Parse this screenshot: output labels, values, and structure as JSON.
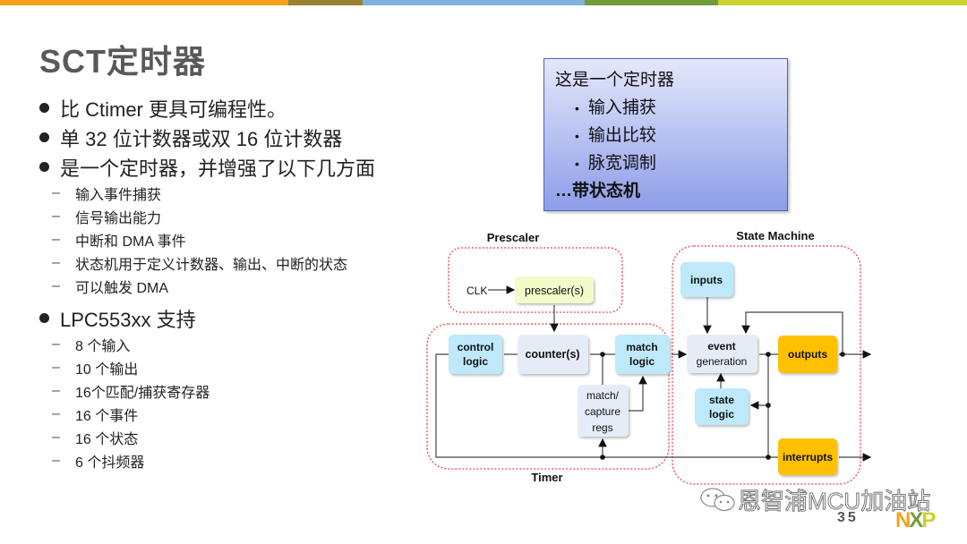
{
  "topbar_colors": [
    "#f7a11a",
    "#9b8132",
    "#7fb2dc",
    "#739b3c",
    "#c9d22e"
  ],
  "slide": {
    "title": "SCT定时器",
    "page_number": "35"
  },
  "bullets": [
    {
      "level": 1,
      "text": "比 Ctimer 更具可编程性。"
    },
    {
      "level": 1,
      "text": "单 32 位计数器或双 16 位计数器"
    },
    {
      "level": 1,
      "text": "是一个定时器，并增强了以下几方面"
    },
    {
      "level": 2,
      "text": "输入事件捕获"
    },
    {
      "level": 2,
      "text": "信号输出能力"
    },
    {
      "level": 2,
      "text": "中断和 DMA 事件"
    },
    {
      "level": 2,
      "text": "状态机用于定义计数器、输出、中断的状态"
    },
    {
      "level": 2,
      "text": "可以触发 DMA"
    },
    {
      "level": 1,
      "text": "LPC553xx 支持"
    },
    {
      "level": 2,
      "text": "8 个输入"
    },
    {
      "level": 2,
      "text": "10 个输出"
    },
    {
      "level": 2,
      "text": "16个匹配/捕获寄存器"
    },
    {
      "level": 2,
      "text": "16 个事件"
    },
    {
      "level": 2,
      "text": "16 个状态"
    },
    {
      "level": 2,
      "text": "6 个抖频器"
    }
  ],
  "callout": {
    "heading": "这是一个定时器",
    "items": [
      "输入捕获",
      "输出比较",
      "脉宽调制"
    ],
    "footer": "…带状态机"
  },
  "diagram": {
    "groups": {
      "prescaler": "Prescaler",
      "timer": "Timer",
      "state_machine": "State Machine"
    },
    "clk": "CLK",
    "blocks": {
      "prescaler": "prescaler(s)",
      "control_logic": [
        "control",
        "logic"
      ],
      "counter": "counter(s)",
      "match_logic": [
        "match",
        "logic"
      ],
      "match_capture": [
        "match/",
        "capture",
        "regs"
      ],
      "inputs": "inputs",
      "event_generation": [
        "event",
        "generation"
      ],
      "outputs": "outputs",
      "state_logic": [
        "state",
        "logic"
      ],
      "interrupts": "interrupts"
    },
    "colors": {
      "cyan": "#bde9fb",
      "pale": "#e6ecf7",
      "yellow": "#ffc000",
      "prescaler": "#f2fbc9",
      "dashed": "#ee4444"
    }
  },
  "footer": {
    "watermark": "恩智浦MCU加油站",
    "logo": "NXP"
  }
}
